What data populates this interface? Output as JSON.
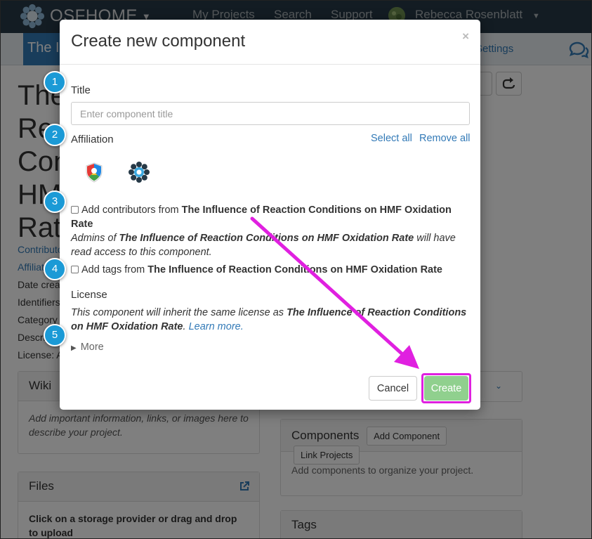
{
  "navbar": {
    "brand": "OSFHOME",
    "links": [
      "My Projects",
      "Search",
      "Support"
    ],
    "user_name": "Rebecca Rosenblatt"
  },
  "project_bar": {
    "title": "The Influence of Reaction Conditions on HMF Oxidation Rate",
    "settings_label": "Settings"
  },
  "page": {
    "title": "The Influence of Reaction Conditions on HMF Oxidation Rate",
    "meta": [
      "Contributors",
      "Affiliated institutions",
      "Date created",
      "Identifiers",
      "Category",
      "Description",
      "License: All rights reserved"
    ],
    "wiki_panel": {
      "title": "Wiki",
      "body": "Add important information, links, or images here to describe your project."
    },
    "files_panel": {
      "title": "Files",
      "body": "Click on a storage provider or drag and drop to upload"
    },
    "components_panel": {
      "title": "Components",
      "add_button": "Add Component",
      "link_button": "Link Projects",
      "body": "Add components to organize your project."
    },
    "tags_panel": {
      "title": "Tags"
    }
  },
  "modal": {
    "title": "Create new component",
    "close": "×",
    "title_label": "Title",
    "title_placeholder": "Enter component title",
    "affiliation_label": "Affiliation",
    "select_all": "Select all",
    "remove_all": "Remove all",
    "add_contributors_prefix": "Add contributors from",
    "project_name": "The Influence of Reaction Conditions on HMF Oxidation Rate",
    "admins_prefix": "Admins of",
    "admins_suffix": "will have read access to this component.",
    "add_tags_prefix": "Add tags from",
    "license_label": "License",
    "license_prefix": "This component will inherit the same license as",
    "learn_more": "Learn more.",
    "more": "More",
    "cancel": "Cancel",
    "create": "Create"
  },
  "steps": [
    "1",
    "2",
    "3",
    "4",
    "5"
  ],
  "colors": {
    "navbar": "#263947",
    "link": "#337ab7",
    "create_button": "#90d08e",
    "highlight": "#e020e0",
    "step_badge": "#1b9ad6"
  }
}
